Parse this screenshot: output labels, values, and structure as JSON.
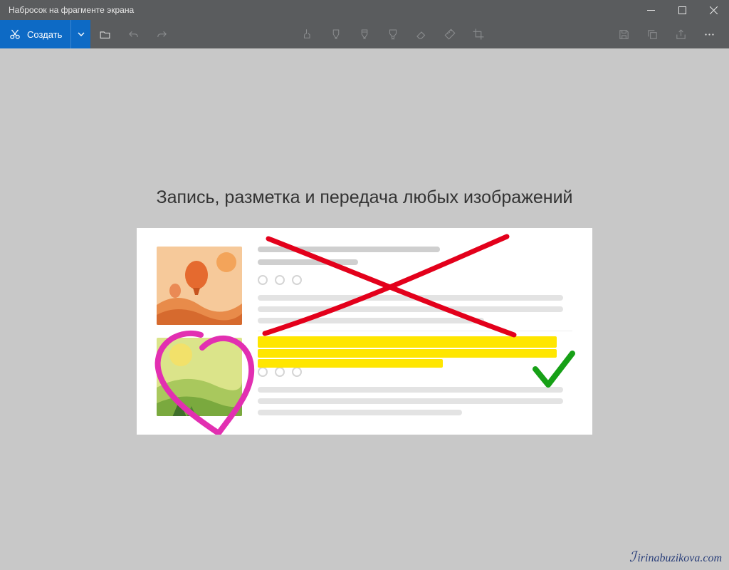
{
  "title": "Набросок на фрагменте экрана",
  "toolbar": {
    "new_label": "Создать"
  },
  "headline": "Запись, разметка и передача любых изображений",
  "watermark": "irinabuzikova.com",
  "colors": {
    "accent": "#0d6ac5",
    "chrome": "#5a5c5e",
    "canvas": "#c8c8c8",
    "ink_red": "#e3001b",
    "ink_yellow": "#ffe600",
    "ink_magenta": "#e22fb1",
    "ink_green": "#16a016"
  },
  "icons": {
    "minimize": "minimize-icon",
    "maximize": "maximize-icon",
    "close": "close-icon",
    "new": "new-snip-icon",
    "chevron": "chevron-down-icon",
    "open": "folder-open-icon",
    "undo": "undo-icon",
    "redo": "redo-icon",
    "touch": "touch-writing-icon",
    "ballpoint": "ballpoint-pen-icon",
    "pencil": "pencil-icon",
    "highlighter": "highlighter-icon",
    "eraser": "eraser-icon",
    "ruler": "ruler-icon",
    "crop": "crop-icon",
    "save": "save-icon",
    "copy": "copy-icon",
    "share": "share-icon",
    "more": "more-icon"
  }
}
